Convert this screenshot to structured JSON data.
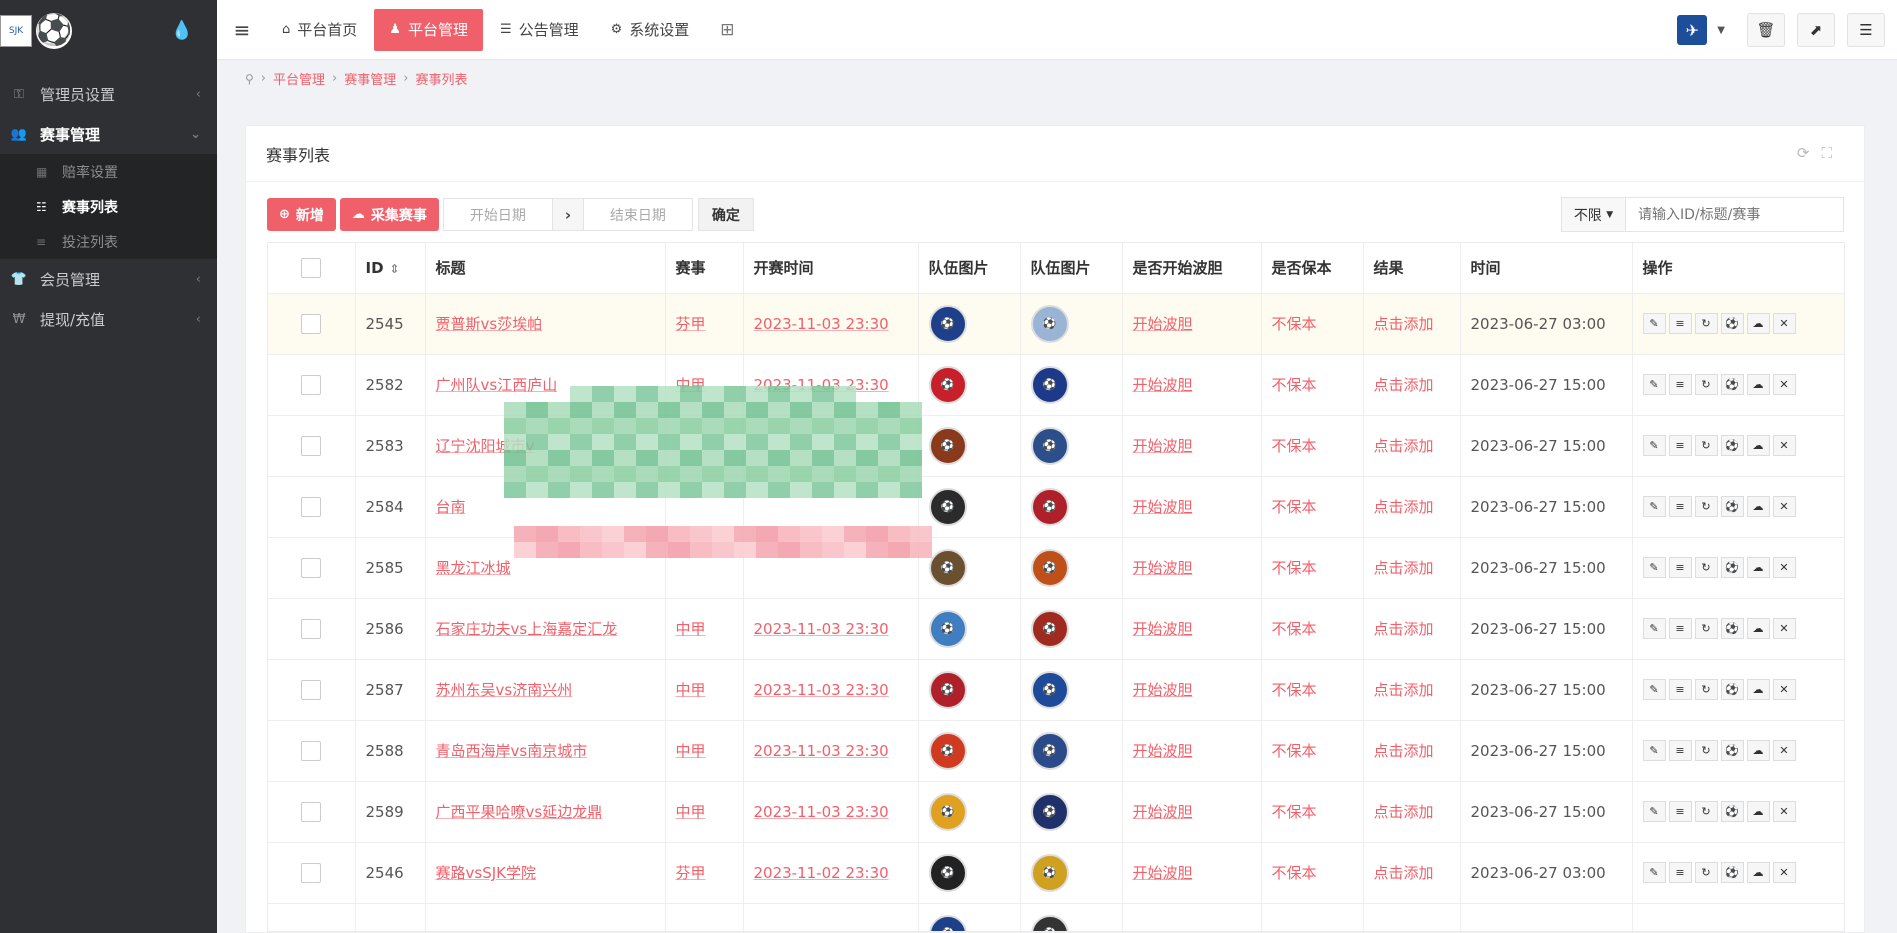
{
  "sidebar": {
    "logo_text": "SJK",
    "menu": [
      {
        "label": "管理员设置",
        "icon": "key-icon",
        "glyph": "⚿"
      },
      {
        "label": "赛事管理",
        "icon": "users-icon",
        "glyph": "👥"
      },
      {
        "label": "会员管理",
        "icon": "user-icon",
        "glyph": "👕"
      },
      {
        "label": "提现/充值",
        "icon": "yen-icon",
        "glyph": "₩"
      }
    ],
    "sub_menu": [
      {
        "label": "赔率设置"
      },
      {
        "label": "赛事列表"
      },
      {
        "label": "投注列表"
      }
    ]
  },
  "topbar": {
    "tabs": [
      {
        "label": "平台首页",
        "icon": "home-icon"
      },
      {
        "label": "平台管理",
        "icon": "user-icon"
      },
      {
        "label": "公告管理",
        "icon": "list-icon"
      },
      {
        "label": "系统设置",
        "icon": "gear-icon"
      }
    ]
  },
  "breadcrumb": [
    "平台管理",
    "赛事管理",
    "赛事列表"
  ],
  "card": {
    "title": "赛事列表",
    "add_label": "新增",
    "collect_label": "采集赛事",
    "start_date_placeholder": "开始日期",
    "end_date_placeholder": "结束日期",
    "confirm_label": "确定",
    "filter_value": "不限",
    "search_placeholder": "请输入ID/标题/赛事"
  },
  "table": {
    "headers": [
      "ID",
      "标题",
      "赛事",
      "开赛时间",
      "队伍图片",
      "队伍图片",
      "是否开始波胆",
      "是否保本",
      "结果",
      "时间",
      "操作"
    ],
    "rows": [
      {
        "id": "2545",
        "title": "贾普斯vs莎埃帕",
        "league": "芬甲",
        "start": "2023-11-03 23:30",
        "bodan": "开始波胆",
        "baoben": "不保本",
        "result": "点击添加",
        "time": "2023-06-27 03:00",
        "c1": "#1e3f8a",
        "c2": "#9ab4d6"
      },
      {
        "id": "2582",
        "title": "广州队vs江西庐山",
        "league": "中甲",
        "start": "2023-11-03 23:30",
        "bodan": "开始波胆",
        "baoben": "不保本",
        "result": "点击添加",
        "time": "2023-06-27 15:00",
        "c1": "#c8202a",
        "c2": "#1d3a8a"
      },
      {
        "id": "2583",
        "title": "辽宁沈阳城市v",
        "league": "",
        "start": "",
        "bodan": "开始波胆",
        "baoben": "不保本",
        "result": "点击添加",
        "time": "2023-06-27 15:00",
        "c1": "#8a3a1a",
        "c2": "#2b4f8a"
      },
      {
        "id": "2584",
        "title": "台南",
        "league": "",
        "start": "",
        "bodan": "开始波胆",
        "baoben": "不保本",
        "result": "点击添加",
        "time": "2023-06-27 15:00",
        "c1": "#2b2b2b",
        "c2": "#b0202a"
      },
      {
        "id": "2585",
        "title": "黑龙江冰城",
        "league": "",
        "start": "",
        "bodan": "开始波胆",
        "baoben": "不保本",
        "result": "点击添加",
        "time": "2023-06-27 15:00",
        "c1": "#6b5030",
        "c2": "#c0501a"
      },
      {
        "id": "2586",
        "title": "石家庄功夫vs上海嘉定汇龙",
        "league": "中甲",
        "start": "2023-11-03 23:30",
        "bodan": "开始波胆",
        "baoben": "不保本",
        "result": "点击添加",
        "time": "2023-06-27 15:00",
        "c1": "#3f7ec0",
        "c2": "#a02a20"
      },
      {
        "id": "2587",
        "title": "苏州东吴vs济南兴州",
        "league": "中甲",
        "start": "2023-11-03 23:30",
        "bodan": "开始波胆",
        "baoben": "不保本",
        "result": "点击添加",
        "time": "2023-06-27 15:00",
        "c1": "#b0202a",
        "c2": "#1e4a9a"
      },
      {
        "id": "2588",
        "title": "青岛西海岸vs南京城市",
        "league": "中甲",
        "start": "2023-11-03 23:30",
        "bodan": "开始波胆",
        "baoben": "不保本",
        "result": "点击添加",
        "time": "2023-06-27 15:00",
        "c1": "#d03a20",
        "c2": "#2a4a8a"
      },
      {
        "id": "2589",
        "title": "广西平果哈嘹vs延边龙鼎",
        "league": "中甲",
        "start": "2023-11-03 23:30",
        "bodan": "开始波胆",
        "baoben": "不保本",
        "result": "点击添加",
        "time": "2023-06-27 15:00",
        "c1": "#e0a020",
        "c2": "#20306a"
      },
      {
        "id": "2546",
        "title": "赛路vsSJK学院",
        "league": "芬甲",
        "start": "2023-11-02 23:30",
        "bodan": "开始波胆",
        "baoben": "不保本",
        "result": "点击添加",
        "time": "2023-06-27 03:00",
        "c1": "#222222",
        "c2": "#d0a020"
      },
      {
        "id": "",
        "title": "",
        "league": "",
        "start": "",
        "bodan": "",
        "baoben": "",
        "result": "",
        "time": "",
        "c1": "#1e3f8a",
        "c2": "#333333"
      }
    ]
  },
  "colors": {
    "accent": "#f0606a",
    "sidebar": "#2f3033"
  }
}
